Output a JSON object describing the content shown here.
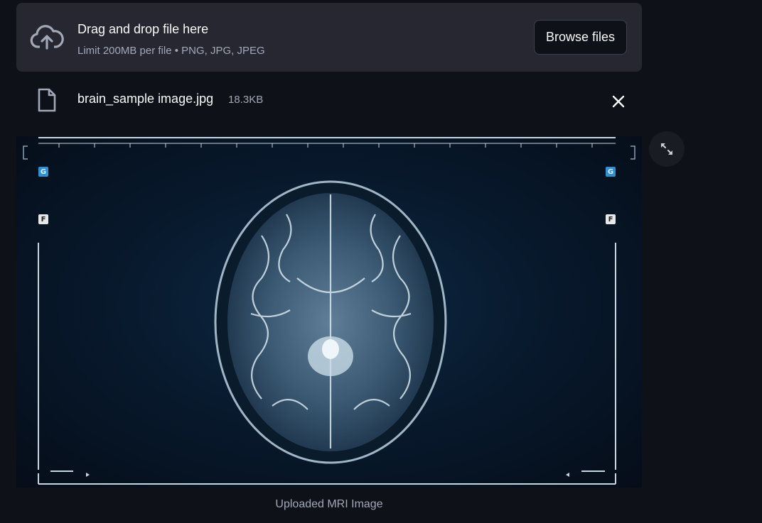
{
  "uploader": {
    "title": "Drag and drop file here",
    "subtitle": "Limit 200MB per file • PNG, JPG, JPEG",
    "browse_label": "Browse files",
    "icon": "cloud-upload-icon"
  },
  "file": {
    "name": "brain_sample image.jpg",
    "size": "18.3KB",
    "icon": "file-icon",
    "remove_icon": "close-icon"
  },
  "image": {
    "caption": "Uploaded MRI Image",
    "overlay_tags": {
      "g": "G",
      "f": "F"
    },
    "expand_icon": "fullscreen-icon"
  },
  "colors": {
    "background": "#0e1117",
    "panel": "#262730",
    "text": "#fafafa",
    "muted": "#a3a8b8"
  }
}
